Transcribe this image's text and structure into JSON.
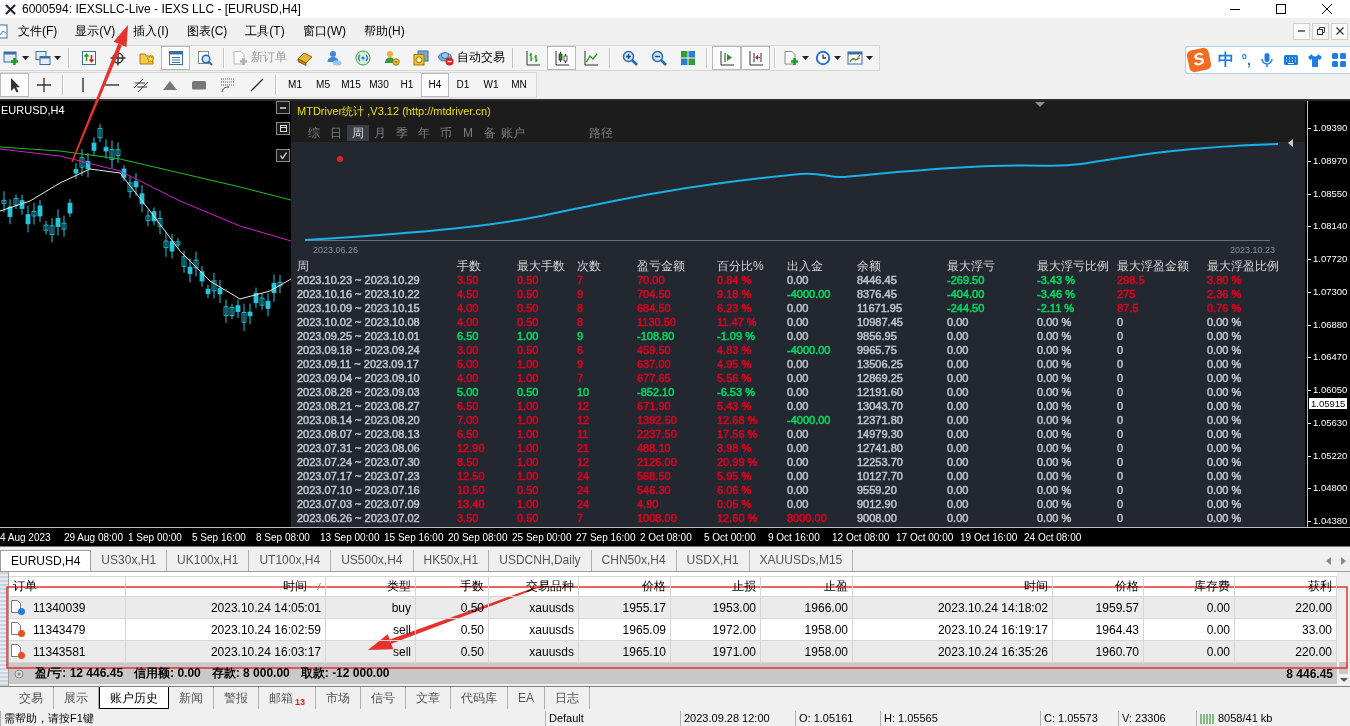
{
  "window": {
    "title": "6000594: IEXSLLC-Live - IEXS LLC - [EURUSD,H4]"
  },
  "menu": [
    "文件(F)",
    "显示(V)",
    "插入(I)",
    "图表(C)",
    "工具(T)",
    "窗口(W)",
    "帮助(H)"
  ],
  "toolbar": [
    [
      {
        "kind": "icon",
        "on": false,
        "disabled": false
      },
      {
        "kind": "icon",
        "on": false,
        "disabled": false
      }
    ],
    [
      {
        "kind": "icon",
        "on": false,
        "disabled": false
      },
      {
        "kind": "icon",
        "on": false,
        "disabled": false
      },
      {
        "kind": "icon",
        "on": false,
        "disabled": false
      },
      {
        "kind": "icon",
        "on": true,
        "disabled": false
      },
      {
        "kind": "icon",
        "on": false,
        "disabled": false
      }
    ],
    [
      {
        "kind": "labeled",
        "label": "新订单",
        "on": false,
        "disabled": true
      },
      {
        "kind": "icon",
        "on": false,
        "disabled": false
      },
      {
        "kind": "icon",
        "on": false,
        "disabled": false
      },
      {
        "kind": "icon",
        "on": false,
        "disabled": false
      },
      {
        "kind": "icon",
        "on": false,
        "disabled": false
      },
      {
        "kind": "icon",
        "on": false,
        "disabled": false
      },
      {
        "kind": "labeled",
        "label": "自动交易",
        "on": false,
        "disabled": false
      }
    ],
    [
      {
        "kind": "icon",
        "on": false,
        "disabled": false
      },
      {
        "kind": "icon",
        "on": true,
        "disabled": false
      },
      {
        "kind": "icon",
        "on": false,
        "disabled": false
      }
    ],
    [
      {
        "kind": "icon",
        "on": false,
        "disabled": false
      },
      {
        "kind": "icon",
        "on": false,
        "disabled": false
      },
      {
        "kind": "icon",
        "on": false,
        "disabled": false
      }
    ],
    [
      {
        "kind": "icon",
        "on": true,
        "disabled": false
      },
      {
        "kind": "icon",
        "on": true,
        "disabled": false
      }
    ],
    [
      {
        "kind": "icon",
        "on": false,
        "disabled": false
      },
      {
        "kind": "icon",
        "on": false,
        "disabled": false
      },
      {
        "kind": "icon",
        "on": false,
        "disabled": false
      }
    ]
  ],
  "drawing_tools": [
    [
      {
        "selected": true
      },
      {
        "selected": false
      }
    ],
    [
      {
        "selected": false
      },
      {
        "selected": false
      },
      {
        "selected": false
      },
      {
        "selected": false
      },
      {
        "selected": false
      },
      {
        "selected": false
      },
      {
        "selected": false
      }
    ]
  ],
  "timeframes": [
    {
      "label": "M1",
      "selected": false
    },
    {
      "label": "M5",
      "selected": false
    },
    {
      "label": "M15",
      "selected": false
    },
    {
      "label": "M30",
      "selected": false
    },
    {
      "label": "H1",
      "selected": false
    },
    {
      "label": "H4",
      "selected": true
    },
    {
      "label": "D1",
      "selected": false
    },
    {
      "label": "W1",
      "selected": false
    },
    {
      "label": "MN",
      "selected": false
    }
  ],
  "ime_bar": {
    "logo": "S",
    "mode": "中",
    "punctuation": "°,"
  },
  "chart": {
    "symbol": "EURUSD,H4",
    "price_axis": [
      "1.09390",
      "1.08970",
      "1.08550",
      "1.08140",
      "1.07720",
      "1.07300",
      "1.06880",
      "1.06470",
      "1.06050",
      "1.05630",
      "1.05220",
      "1.04800",
      "1.04380"
    ],
    "current_price": "1.05915",
    "time_axis": [
      "4 Aug 2023",
      "29 Aug 08:00",
      "1 Sep 00:00",
      "5 Sep 16:00",
      "8 Sep 08:00",
      "13 Sep 00:00",
      "15 Sep 16:00",
      "20 Sep 08:00",
      "25 Sep 00:00",
      "27 Sep 16:00",
      "2 Oct 08:00",
      "5 Oct 00:00",
      "9 Oct 16:00",
      "12 Oct 08:00",
      "17 Oct 00:00",
      "19 Oct 16:00",
      "24 Oct 08:00"
    ]
  },
  "stats_panel": {
    "title": "MTDriver统计 ,V3.12 (http://mtdriver.cn)",
    "tabs": [
      {
        "label": "综",
        "selected": false
      },
      {
        "label": "日",
        "selected": false
      },
      {
        "label": "周",
        "selected": true
      },
      {
        "label": "月",
        "selected": false
      },
      {
        "label": "季",
        "selected": false
      },
      {
        "label": "年",
        "selected": false
      },
      {
        "label": "币",
        "selected": false
      },
      {
        "label": "M",
        "selected": false
      },
      {
        "label": "备",
        "selected": false
      },
      {
        "label": "账户",
        "selected": false
      },
      {
        "label": "路径",
        "selected": false
      }
    ],
    "curve": {
      "start_label": "2023.06.26",
      "end_label": "2023.10.23"
    },
    "columns": [
      "周",
      "手数",
      "最大手数",
      "次数",
      "盈亏金额",
      "百分比%",
      "出入金",
      "余额",
      "最大浮亏",
      "最大浮亏比例",
      "最大浮盈金额",
      "最大浮盈比例"
    ],
    "rows": [
      {
        "cells": [
          {
            "text": "2023.10.23 ~ 2023.10.29"
          },
          {
            "text": "3.50",
            "color": "#e00020"
          },
          {
            "text": "0.50",
            "color": "#e00020"
          },
          {
            "text": "7",
            "color": "#e00020"
          },
          {
            "text": "70.00",
            "color": "#e00020"
          },
          {
            "text": "0.84 %",
            "color": "#e00020"
          },
          {
            "text": "0.00"
          },
          {
            "text": "8446.45"
          },
          {
            "text": "-269.50",
            "color": "#00dc64"
          },
          {
            "text": "-3.43 %",
            "color": "#00dc64"
          },
          {
            "text": "298.5",
            "color": "#e00020"
          },
          {
            "text": "3.80 %",
            "color": "#e00020"
          }
        ]
      },
      {
        "cells": [
          {
            "text": "2023.10.16 ~ 2023.10.22"
          },
          {
            "text": "4.50",
            "color": "#e00020"
          },
          {
            "text": "0.50",
            "color": "#e00020"
          },
          {
            "text": "9",
            "color": "#e00020"
          },
          {
            "text": "704.50",
            "color": "#e00020"
          },
          {
            "text": "9.18 %",
            "color": "#e00020"
          },
          {
            "text": "-4000.00",
            "color": "#00dc64"
          },
          {
            "text": "8376.45"
          },
          {
            "text": "-404.00",
            "color": "#00dc64"
          },
          {
            "text": "-3.46 %",
            "color": "#00dc64"
          },
          {
            "text": "275",
            "color": "#e00020"
          },
          {
            "text": "2.36 %",
            "color": "#e00020"
          }
        ]
      },
      {
        "cells": [
          {
            "text": "2023.10.09 ~ 2023.10.15"
          },
          {
            "text": "4.00",
            "color": "#e00020"
          },
          {
            "text": "0.50",
            "color": "#e00020"
          },
          {
            "text": "8",
            "color": "#e00020"
          },
          {
            "text": "684.50",
            "color": "#e00020"
          },
          {
            "text": "6.23 %",
            "color": "#e00020"
          },
          {
            "text": "0.00"
          },
          {
            "text": "11671.95"
          },
          {
            "text": "-244.50",
            "color": "#00dc64"
          },
          {
            "text": "-2.11 %",
            "color": "#00dc64"
          },
          {
            "text": "87.5",
            "color": "#e00020"
          },
          {
            "text": "0.76 %",
            "color": "#e00020"
          }
        ]
      },
      {
        "cells": [
          {
            "text": "2023.10.02 ~ 2023.10.08"
          },
          {
            "text": "4.00",
            "color": "#e00020"
          },
          {
            "text": "0.50",
            "color": "#e00020"
          },
          {
            "text": "8",
            "color": "#e00020"
          },
          {
            "text": "1130.50",
            "color": "#e00020"
          },
          {
            "text": "11.47 %",
            "color": "#e00020"
          },
          {
            "text": "0.00"
          },
          {
            "text": "10987.45"
          },
          {
            "text": "0.00"
          },
          {
            "text": "0.00 %"
          },
          {
            "text": "0"
          },
          {
            "text": "0.00 %"
          }
        ]
      },
      {
        "cells": [
          {
            "text": "2023.09.25 ~ 2023.10.01"
          },
          {
            "text": "6.50",
            "color": "#00dc64"
          },
          {
            "text": "1.00",
            "color": "#00dc64"
          },
          {
            "text": "9",
            "color": "#00dc64"
          },
          {
            "text": "-108.80",
            "color": "#00dc64"
          },
          {
            "text": "-1.09 %",
            "color": "#00dc64"
          },
          {
            "text": "0.00"
          },
          {
            "text": "9856.95"
          },
          {
            "text": "0.00"
          },
          {
            "text": "0.00 %"
          },
          {
            "text": "0"
          },
          {
            "text": "0.00 %"
          }
        ]
      },
      {
        "cells": [
          {
            "text": "2023.09.18 ~ 2023.09.24"
          },
          {
            "text": "3.00",
            "color": "#e00020"
          },
          {
            "text": "0.50",
            "color": "#e00020"
          },
          {
            "text": "6",
            "color": "#e00020"
          },
          {
            "text": "459.50",
            "color": "#e00020"
          },
          {
            "text": "4.83 %",
            "color": "#e00020"
          },
          {
            "text": "-4000.00",
            "color": "#00dc64"
          },
          {
            "text": "9965.75"
          },
          {
            "text": "0.00"
          },
          {
            "text": "0.00 %"
          },
          {
            "text": "0"
          },
          {
            "text": "0.00 %"
          }
        ]
      },
      {
        "cells": [
          {
            "text": "2023.09.11 ~ 2023.09.17"
          },
          {
            "text": "5.00",
            "color": "#e00020"
          },
          {
            "text": "1.00",
            "color": "#e00020"
          },
          {
            "text": "9",
            "color": "#e00020"
          },
          {
            "text": "637.00",
            "color": "#e00020"
          },
          {
            "text": "4.95 %",
            "color": "#e00020"
          },
          {
            "text": "0.00"
          },
          {
            "text": "13506.25"
          },
          {
            "text": "0.00"
          },
          {
            "text": "0.00 %"
          },
          {
            "text": "0"
          },
          {
            "text": "0.00 %"
          }
        ]
      },
      {
        "cells": [
          {
            "text": "2023.09.04 ~ 2023.09.10"
          },
          {
            "text": "4.00",
            "color": "#e00020"
          },
          {
            "text": "1.00",
            "color": "#e00020"
          },
          {
            "text": "7",
            "color": "#e00020"
          },
          {
            "text": "677.65",
            "color": "#e00020"
          },
          {
            "text": "5.56 %",
            "color": "#e00020"
          },
          {
            "text": "0.00"
          },
          {
            "text": "12869.25"
          },
          {
            "text": "0.00"
          },
          {
            "text": "0.00 %"
          },
          {
            "text": "0"
          },
          {
            "text": "0.00 %"
          }
        ]
      },
      {
        "cells": [
          {
            "text": "2023.08.28 ~ 2023.09.03"
          },
          {
            "text": "5.00",
            "color": "#00dc64"
          },
          {
            "text": "0.50",
            "color": "#00dc64"
          },
          {
            "text": "10",
            "color": "#00dc64"
          },
          {
            "text": "-852.10",
            "color": "#00dc64"
          },
          {
            "text": "-6.53 %",
            "color": "#00dc64"
          },
          {
            "text": "0.00"
          },
          {
            "text": "12191.60"
          },
          {
            "text": "0.00"
          },
          {
            "text": "0.00 %"
          },
          {
            "text": "0"
          },
          {
            "text": "0.00 %"
          }
        ]
      },
      {
        "cells": [
          {
            "text": "2023.08.21 ~ 2023.08.27"
          },
          {
            "text": "6.50",
            "color": "#e00020"
          },
          {
            "text": "1.00",
            "color": "#e00020"
          },
          {
            "text": "12",
            "color": "#e00020"
          },
          {
            "text": "671.90",
            "color": "#e00020"
          },
          {
            "text": "5.43 %",
            "color": "#e00020"
          },
          {
            "text": "0.00"
          },
          {
            "text": "13043.70"
          },
          {
            "text": "0.00"
          },
          {
            "text": "0.00 %"
          },
          {
            "text": "0"
          },
          {
            "text": "0.00 %"
          }
        ]
      },
      {
        "cells": [
          {
            "text": "2023.08.14 ~ 2023.08.20"
          },
          {
            "text": "7.00",
            "color": "#e00020"
          },
          {
            "text": "1.00",
            "color": "#e00020"
          },
          {
            "text": "12",
            "color": "#e00020"
          },
          {
            "text": "1392.50",
            "color": "#e00020"
          },
          {
            "text": "12.68 %",
            "color": "#e00020"
          },
          {
            "text": "-4000.00",
            "color": "#00dc64"
          },
          {
            "text": "12371.80"
          },
          {
            "text": "0.00"
          },
          {
            "text": "0.00 %"
          },
          {
            "text": "0"
          },
          {
            "text": "0.00 %"
          }
        ]
      },
      {
        "cells": [
          {
            "text": "2023.08.07 ~ 2023.08.13"
          },
          {
            "text": "6.50",
            "color": "#e00020"
          },
          {
            "text": "1.00",
            "color": "#e00020"
          },
          {
            "text": "11",
            "color": "#e00020"
          },
          {
            "text": "2237.50",
            "color": "#e00020"
          },
          {
            "text": "17.56 %",
            "color": "#e00020"
          },
          {
            "text": "0.00"
          },
          {
            "text": "14979.30"
          },
          {
            "text": "0.00"
          },
          {
            "text": "0.00 %"
          },
          {
            "text": "0"
          },
          {
            "text": "0.00 %"
          }
        ]
      },
      {
        "cells": [
          {
            "text": "2023.07.31 ~ 2023.08.06"
          },
          {
            "text": "12.90",
            "color": "#e00020"
          },
          {
            "text": "1.00",
            "color": "#e00020"
          },
          {
            "text": "21",
            "color": "#e00020"
          },
          {
            "text": "488.10",
            "color": "#e00020"
          },
          {
            "text": "3.98 %",
            "color": "#e00020"
          },
          {
            "text": "0.00"
          },
          {
            "text": "12741.80"
          },
          {
            "text": "0.00"
          },
          {
            "text": "0.00 %"
          },
          {
            "text": "0"
          },
          {
            "text": "0.00 %"
          }
        ]
      },
      {
        "cells": [
          {
            "text": "2023.07.24 ~ 2023.07.30"
          },
          {
            "text": "8.50",
            "color": "#e00020"
          },
          {
            "text": "1.00",
            "color": "#e00020"
          },
          {
            "text": "12",
            "color": "#e00020"
          },
          {
            "text": "2126.00",
            "color": "#e00020"
          },
          {
            "text": "20.99 %",
            "color": "#e00020"
          },
          {
            "text": "0.00"
          },
          {
            "text": "12253.70"
          },
          {
            "text": "0.00"
          },
          {
            "text": "0.00 %"
          },
          {
            "text": "0"
          },
          {
            "text": "0.00 %"
          }
        ]
      },
      {
        "cells": [
          {
            "text": "2023.07.17 ~ 2023.07.23"
          },
          {
            "text": "12.50",
            "color": "#e00020"
          },
          {
            "text": "1.00",
            "color": "#e00020"
          },
          {
            "text": "24",
            "color": "#e00020"
          },
          {
            "text": "568.50",
            "color": "#e00020"
          },
          {
            "text": "5.95 %",
            "color": "#e00020"
          },
          {
            "text": "0.00"
          },
          {
            "text": "10127.70"
          },
          {
            "text": "0.00"
          },
          {
            "text": "0.00 %"
          },
          {
            "text": "0"
          },
          {
            "text": "0.00 %"
          }
        ]
      },
      {
        "cells": [
          {
            "text": "2023.07.10 ~ 2023.07.16"
          },
          {
            "text": "10.50",
            "color": "#e00020"
          },
          {
            "text": "0.50",
            "color": "#e00020"
          },
          {
            "text": "24",
            "color": "#e00020"
          },
          {
            "text": "546.30",
            "color": "#e00020"
          },
          {
            "text": "6.06 %",
            "color": "#e00020"
          },
          {
            "text": "0.00"
          },
          {
            "text": "9559.20"
          },
          {
            "text": "0.00"
          },
          {
            "text": "0.00 %"
          },
          {
            "text": "0"
          },
          {
            "text": "0.00 %"
          }
        ]
      },
      {
        "cells": [
          {
            "text": "2023.07.03 ~ 2023.07.09"
          },
          {
            "text": "13.40",
            "color": "#e00020"
          },
          {
            "text": "1.00",
            "color": "#e00020"
          },
          {
            "text": "24",
            "color": "#e00020"
          },
          {
            "text": "4.90",
            "color": "#e00020"
          },
          {
            "text": "0.05 %",
            "color": "#e00020"
          },
          {
            "text": "0.00"
          },
          {
            "text": "9012.90"
          },
          {
            "text": "0.00"
          },
          {
            "text": "0.00 %"
          },
          {
            "text": "0"
          },
          {
            "text": "0.00 %"
          }
        ]
      },
      {
        "cells": [
          {
            "text": "2023.06.26 ~ 2023.07.02"
          },
          {
            "text": "3.50",
            "color": "#e00020"
          },
          {
            "text": "0.50",
            "color": "#e00020"
          },
          {
            "text": "7",
            "color": "#e00020"
          },
          {
            "text": "1008.00",
            "color": "#e00020"
          },
          {
            "text": "12.60 %",
            "color": "#e00020"
          },
          {
            "text": "8000.00",
            "color": "#e00020"
          },
          {
            "text": "9008.00"
          },
          {
            "text": "0.00"
          },
          {
            "text": "0.00 %"
          },
          {
            "text": "0"
          },
          {
            "text": "0.00 %"
          }
        ]
      }
    ]
  },
  "chart_tabs": [
    {
      "label": "EURUSD,H4",
      "selected": true
    },
    {
      "label": "US30x,H1",
      "selected": false
    },
    {
      "label": "UK100x,H1",
      "selected": false
    },
    {
      "label": "UT100x,H4",
      "selected": false
    },
    {
      "label": "US500x,H4",
      "selected": false
    },
    {
      "label": "HK50x,H1",
      "selected": false
    },
    {
      "label": "USDCNH,Daily",
      "selected": false
    },
    {
      "label": "CHN50x,H4",
      "selected": false
    },
    {
      "label": "USDX,H1",
      "selected": false
    },
    {
      "label": "XAUUSDs,M15",
      "selected": false
    }
  ],
  "terminal": {
    "columns": [
      {
        "label": "订单",
        "sorted": false
      },
      {
        "label": "时间",
        "sorted": true
      },
      {
        "label": "类型",
        "sorted": false
      },
      {
        "label": "手数",
        "sorted": false
      },
      {
        "label": "交易品种",
        "sorted": false
      },
      {
        "label": "价格",
        "sorted": false
      },
      {
        "label": "止损",
        "sorted": false
      },
      {
        "label": "止盈",
        "sorted": false
      },
      {
        "label": "时间",
        "sorted": false
      },
      {
        "label": "价格",
        "sorted": false
      },
      {
        "label": "库存费",
        "sorted": false
      },
      {
        "label": "获利",
        "sorted": false
      }
    ],
    "rows": [
      {
        "color": "#2b7bd6",
        "cells": [
          "11340039",
          "2023.10.24 14:05:01",
          "buy",
          "0.50",
          "xauusds",
          "1955.17",
          "1953.00",
          "1966.00",
          "2023.10.24 14:18:02",
          "1959.57",
          "0.00",
          "220.00"
        ]
      },
      {
        "color": "#e8501e",
        "cells": [
          "11343479",
          "2023.10.24 16:02:59",
          "sell",
          "0.50",
          "xauusds",
          "1965.09",
          "1972.00",
          "1958.00",
          "2023.10.24 16:19:17",
          "1964.43",
          "0.00",
          "33.00"
        ]
      },
      {
        "color": "#e8501e",
        "cells": [
          "11343581",
          "2023.10.24 16:03:17",
          "sell",
          "0.50",
          "xauusds",
          "1965.10",
          "1971.00",
          "1958.00",
          "2023.10.24 16:35:26",
          "1960.70",
          "0.00",
          "220.00"
        ]
      }
    ],
    "summary": [
      "盈/亏: 12 446.45",
      "信用额: 0.00",
      "存款: 8 000.00",
      "取款: -12 000.00"
    ],
    "total": "8 446.45"
  },
  "bottom_tabs": [
    {
      "label": "交易",
      "selected": false
    },
    {
      "label": "展示",
      "selected": false
    },
    {
      "label": "账户历史",
      "selected": true
    },
    {
      "label": "新闻",
      "selected": false
    },
    {
      "label": "警报",
      "selected": false
    },
    {
      "label": "邮箱",
      "selected": false,
      "badge": "13"
    },
    {
      "label": "市场",
      "selected": false
    },
    {
      "label": "信号",
      "selected": false
    },
    {
      "label": "文章",
      "selected": false
    },
    {
      "label": "代码库",
      "selected": false
    },
    {
      "label": "EA",
      "selected": false
    },
    {
      "label": "日志",
      "selected": false
    }
  ],
  "status_bar": [
    "需帮助，请按F1键",
    "Default",
    "2023.09.28 12:00",
    "O: 1.05161",
    "H: 1.05565",
    "C: 1.05573",
    "V: 23306",
    "8058/41 kb"
  ]
}
